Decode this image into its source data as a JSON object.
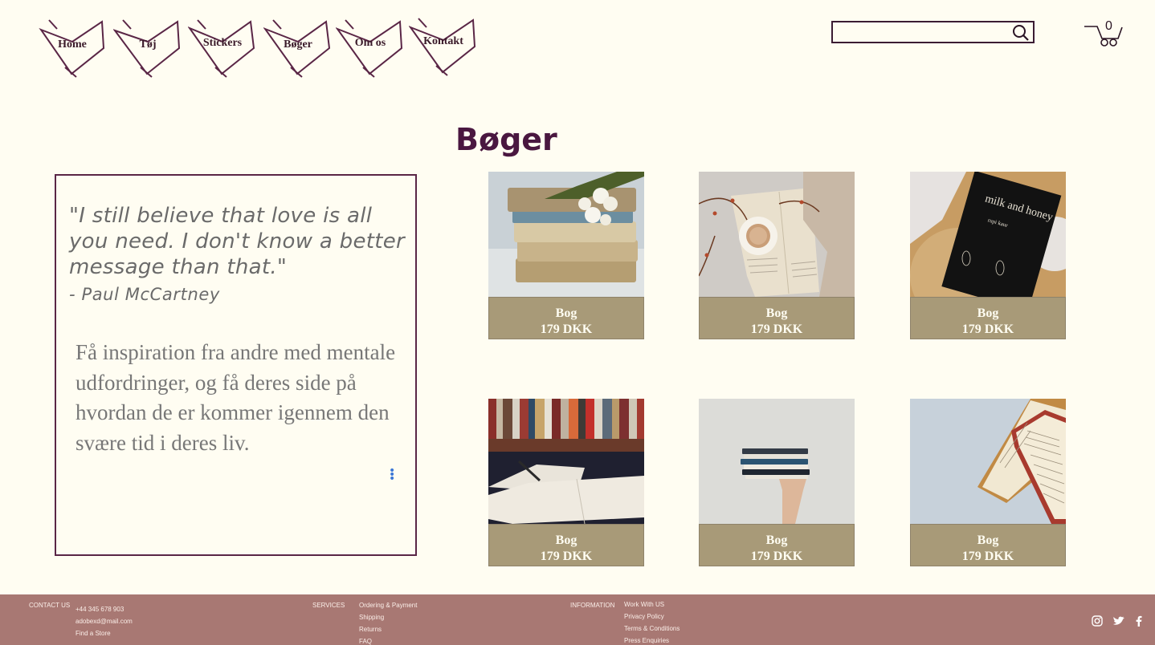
{
  "nav": {
    "items": [
      {
        "label": "Home"
      },
      {
        "label": "Tøj"
      },
      {
        "label": "Stickers"
      },
      {
        "label": "Bøger"
      },
      {
        "label": "Om os"
      },
      {
        "label": "Kontakt"
      }
    ]
  },
  "search": {
    "value": "",
    "placeholder": ""
  },
  "cart": {
    "count": "0"
  },
  "page": {
    "title": "Bøger"
  },
  "quote": {
    "text": "\"I still believe that love is all you need. I don't know a better message than that.\"",
    "author": "- Paul McCartney",
    "body": "Få inspiration fra andre med mentale udfordringer, og få deres side på hvordan de er kommer igennem den svære tid i deres liv."
  },
  "products": [
    {
      "name": "Bog",
      "price": "179 DKK"
    },
    {
      "name": "Bog",
      "price": "179 DKK"
    },
    {
      "name": "Bog",
      "price": "179 DKK",
      "book_title": "milk and honey",
      "book_author": "rupi kaur"
    },
    {
      "name": "Bog",
      "price": "179 DKK"
    },
    {
      "name": "Bog",
      "price": "179 DKK"
    },
    {
      "name": "Bog",
      "price": "179 DKK"
    }
  ],
  "footer": {
    "contact": {
      "heading": "CONTACT US",
      "phone": "+44 345 678 903",
      "email": "adobexd@mail.com",
      "link": "Find a Store"
    },
    "services": {
      "heading": "SERVICES",
      "items": [
        "Ordering & Payment",
        "Shipping",
        "Returns",
        "FAQ"
      ]
    },
    "information": {
      "heading": "INFORMATION",
      "items": [
        "Work With US",
        "Privacy Policy",
        "Terms & Conditions",
        "Press Enquiries"
      ]
    },
    "social_icons": [
      "instagram-icon",
      "twitter-icon",
      "facebook-icon"
    ]
  },
  "colors": {
    "background": "#fffdf2",
    "accent": "#4a1740",
    "nav_outline": "#5a2646",
    "product_label": "#a89a78",
    "footer": "#a87873"
  }
}
